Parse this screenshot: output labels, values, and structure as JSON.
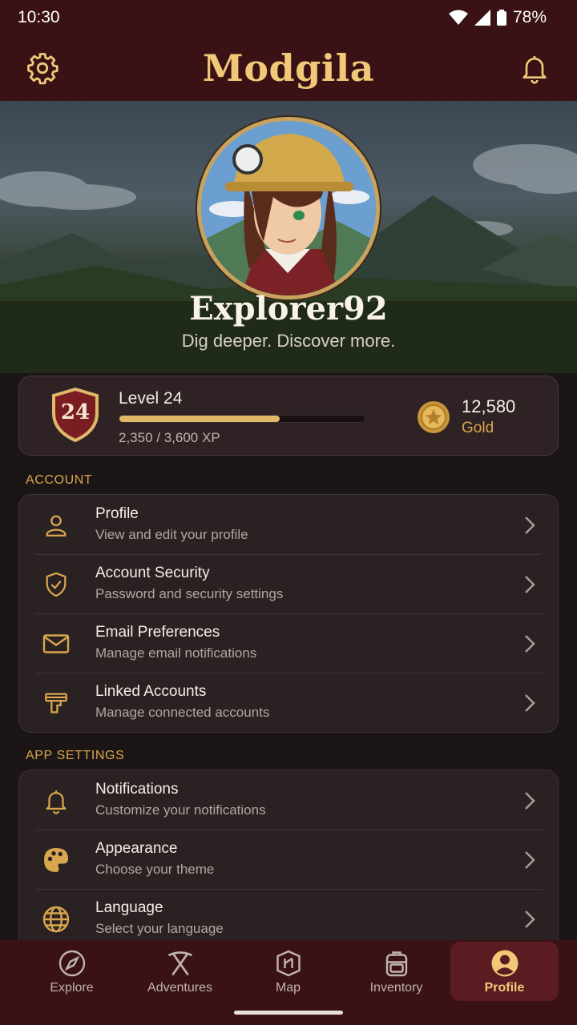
{
  "status": {
    "time": "10:30",
    "battery": "78%"
  },
  "header": {
    "title": "Modgila",
    "left_icon": "gear-icon",
    "right_icon": "bell-icon"
  },
  "profile": {
    "username": "Explorer92",
    "tagline": "Dig deeper. Discover more."
  },
  "stats": {
    "level_number": "24",
    "level_label": "Level 24",
    "xp_text": "2,350 / 3,600 XP",
    "xp_progress": 0.653,
    "gold_amount": "12,580",
    "gold_label": "Gold"
  },
  "account": {
    "section_label": "ACCOUNT",
    "items": [
      {
        "title": "Profile",
        "subtitle": "View and edit your profile",
        "icon": "user-icon"
      },
      {
        "title": "Account Security",
        "subtitle": "Password and security settings",
        "icon": "shield-check-icon"
      },
      {
        "title": "Email Preferences",
        "subtitle": "Manage email notifications",
        "icon": "envelope-icon"
      },
      {
        "title": "Linked Accounts",
        "subtitle": "Manage connected accounts",
        "icon": "link-accounts-icon"
      }
    ]
  },
  "app_settings": {
    "section_label": "APP SETTINGS",
    "items": [
      {
        "title": "Notifications",
        "subtitle": "Customize your notifications",
        "icon": "bell-icon"
      },
      {
        "title": "Appearance",
        "subtitle": "Choose your theme",
        "icon": "palette-icon"
      },
      {
        "title": "Language",
        "subtitle": "Select your language",
        "icon": "globe-icon"
      }
    ]
  },
  "nav": {
    "items": [
      {
        "label": "Explore",
        "icon": "compass-icon"
      },
      {
        "label": "Adventures",
        "icon": "pickaxe-icon"
      },
      {
        "label": "Map",
        "icon": "map-icon"
      },
      {
        "label": "Inventory",
        "icon": "backpack-icon"
      },
      {
        "label": "Profile",
        "icon": "profile-icon",
        "active": true
      }
    ]
  },
  "colors": {
    "accent": "#f0c878",
    "bar": "#3a1216",
    "gold": "#d8a64e"
  }
}
